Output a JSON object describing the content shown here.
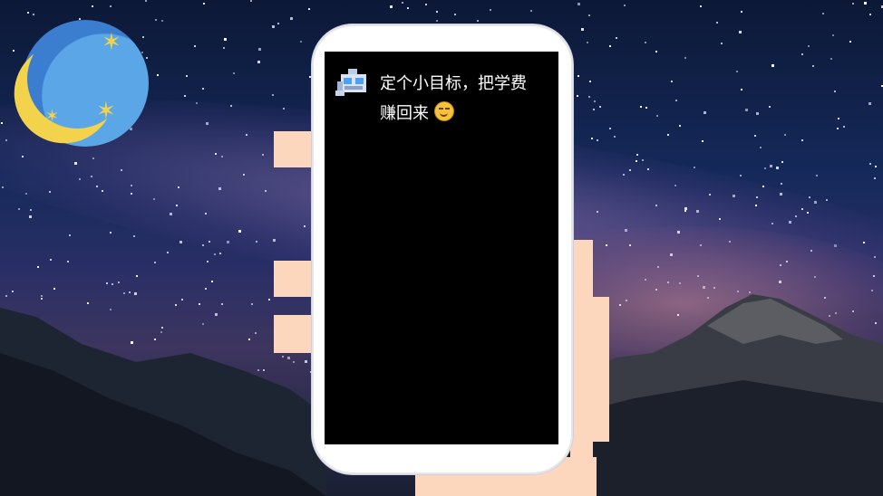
{
  "message": {
    "text_line1": "定个小目标，把学费",
    "text_line2": "赚回来",
    "emoji": "smile-emoji"
  },
  "icons": {
    "avatar": "robot-avatar-icon",
    "moon": "moon-icon"
  },
  "colors": {
    "screen": "#000000",
    "phone_frame": "#ffffff",
    "hand": "#fdd7bd",
    "text": "#ffffff",
    "moon_blue": "#5aa6e6",
    "moon_yellow": "#f4d34c"
  }
}
